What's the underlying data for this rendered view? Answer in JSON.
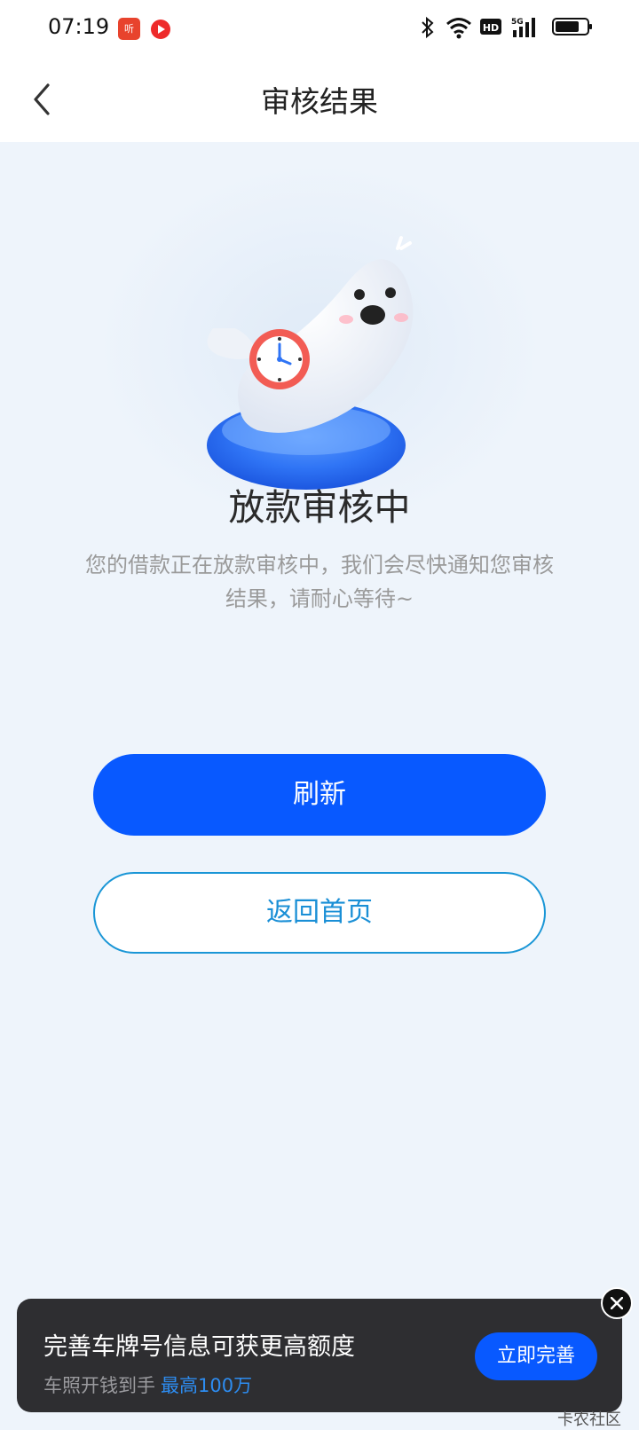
{
  "status_bar": {
    "time": "07:19",
    "app1_label": "听",
    "network": "5G",
    "hd": "HD"
  },
  "nav": {
    "title": "审核结果"
  },
  "result": {
    "title": "放款审核中",
    "description": "您的借款正在放款审核中，我们会尽快通知您审核结果，请耐心等待~"
  },
  "buttons": {
    "refresh": "刷新",
    "home": "返回首页"
  },
  "banner": {
    "main": "完善车牌号信息可获更高额度",
    "sub": "车照开钱到手",
    "highlight": "最高100万",
    "cta": "立即完善"
  },
  "watermark": "卡农社区",
  "colors": {
    "primary": "#0859ff",
    "outline": "#1a96d6",
    "background": "#eef4fb"
  }
}
